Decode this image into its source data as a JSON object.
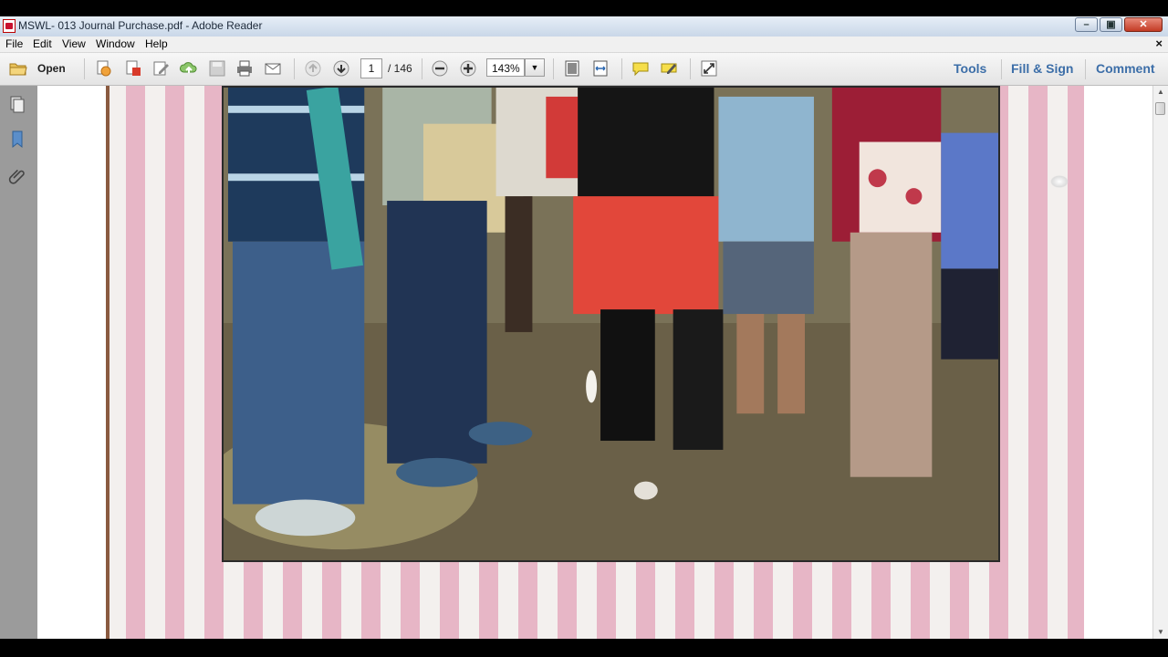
{
  "window": {
    "title": "MSWL- 013 Journal Purchase.pdf - Adobe Reader",
    "minimize_glyph": "–",
    "maximize_glyph": "▣",
    "close_glyph": "✕"
  },
  "menu": {
    "items": [
      "File",
      "Edit",
      "View",
      "Window",
      "Help"
    ],
    "close_glyph": "×"
  },
  "toolbar": {
    "open_label": "Open",
    "page_current": "1",
    "page_total": "/ 146",
    "zoom": "143%",
    "zoom_drop_glyph": "▼",
    "tools_label": "Tools",
    "fill_sign_label": "Fill & Sign",
    "comment_label": "Comment",
    "icons": [
      "folder-open-icon",
      "create-pdf-icon",
      "export-pdf-icon",
      "edit-pdf-icon",
      "upload-cloud-icon",
      "save-icon",
      "print-icon",
      "email-icon",
      "previous-page-icon",
      "next-page-icon",
      "zoom-out-icon",
      "zoom-in-icon",
      "fit-page-icon",
      "fit-width-icon",
      "comment-bubble-icon",
      "highlight-icon",
      "expand-icon"
    ]
  },
  "scrollbar": {
    "up_glyph": "▲",
    "down_glyph": "▼"
  },
  "colors": {
    "accent_link": "#3c6ea8",
    "title_bar": "#c9d7e8",
    "pink_stripe": "#e7b6c6"
  }
}
